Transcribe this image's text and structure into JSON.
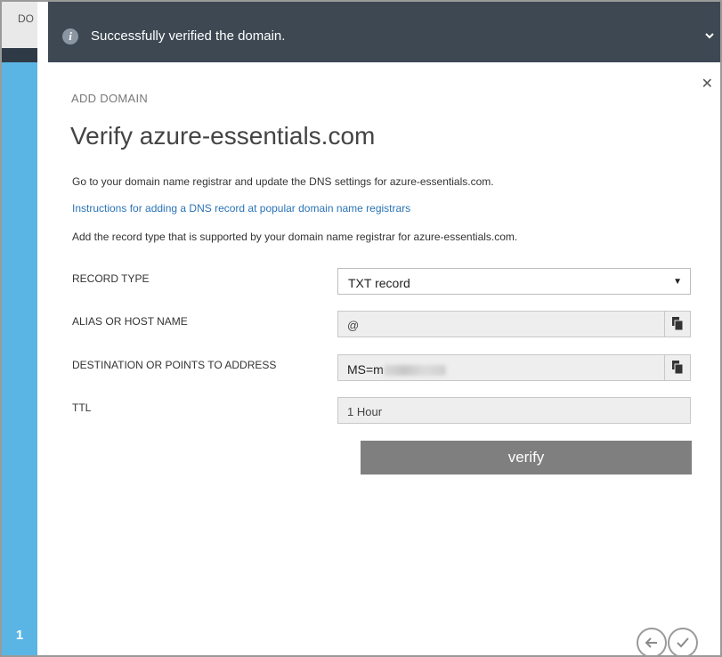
{
  "background": {
    "tab_label": "DO"
  },
  "stepper": {
    "current_step": "1"
  },
  "notification": {
    "icon": "info-icon",
    "message": "Successfully verified the domain."
  },
  "dialog": {
    "subtitle": "ADD DOMAIN",
    "title": "Verify azure-essentials.com",
    "instruction": "Go to your domain name registrar and update the DNS settings for azure-essentials.com.",
    "help_link": "Instructions for adding a DNS record at popular domain name registrars",
    "record_note": "Add the record type that is supported by your domain name registrar for azure-essentials.com.",
    "form": {
      "record_type": {
        "label": "RECORD TYPE",
        "value": "TXT record"
      },
      "alias": {
        "label": "ALIAS OR HOST NAME",
        "value": "@"
      },
      "destination": {
        "label": "DESTINATION OR POINTS TO ADDRESS",
        "value": "MS=m"
      },
      "ttl": {
        "label": "TTL",
        "value": "1 Hour"
      }
    },
    "verify_label": "verify"
  },
  "colors": {
    "notification_bg": "#3d4852",
    "step_rail": "#5bb5e4",
    "link": "#2b74b5",
    "verify_button": "#7f7f7f"
  }
}
